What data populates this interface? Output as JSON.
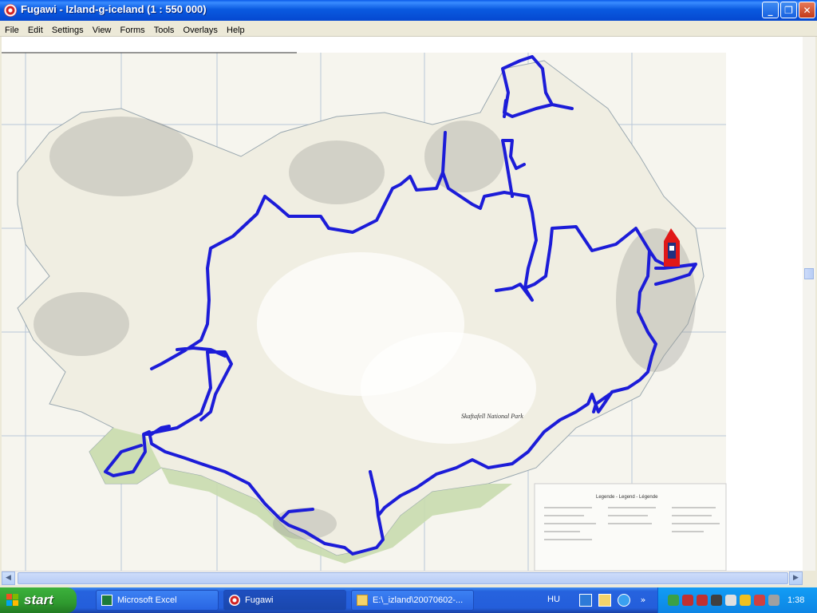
{
  "window": {
    "title": "Fugawi - Izland-g-iceland  (1 : 550 000)",
    "controls": {
      "minimize": "_",
      "maximize": "❐",
      "close": "✕"
    }
  },
  "menu": [
    "File",
    "Edit",
    "Settings",
    "View",
    "Forms",
    "Tools",
    "Overlays",
    "Help"
  ],
  "map": {
    "labels": {
      "park": "Skaftafell National Park",
      "legend_title": "Legende - Legend - Légende"
    },
    "colors": {
      "land": "#f2f0e4",
      "coast_lowland": "#c9dcae",
      "route": "#1c1cd8",
      "marker": "#e01818"
    }
  },
  "scrollbars": {
    "left_arrow": "◀",
    "right_arrow": "▶"
  },
  "taskbar": {
    "start_label": "start",
    "tasks": [
      {
        "label": "Microsoft Excel",
        "icon": "excel-icon"
      },
      {
        "label": "Fugawi",
        "icon": "fugawi-icon"
      },
      {
        "label": "E:\\_izland\\20070602-...",
        "icon": "folder-icon"
      }
    ],
    "language": "HU",
    "clock": "1:38"
  }
}
